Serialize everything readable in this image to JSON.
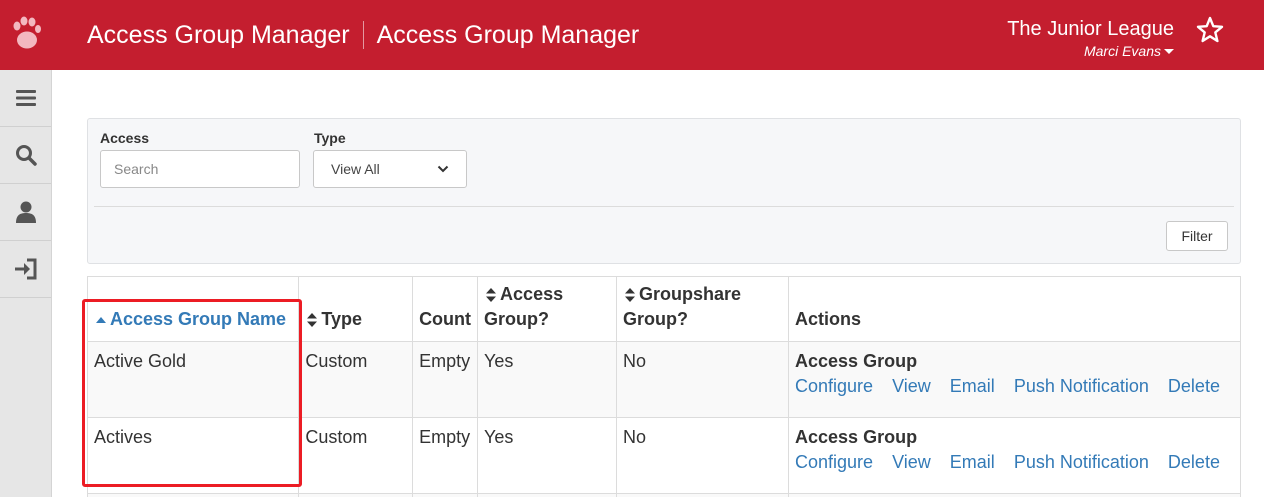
{
  "header": {
    "title_primary": "Access Group Manager",
    "title_secondary": "Access Group Manager",
    "organization": "The Junior League",
    "user_name": "Marci Evans",
    "logo_icon": "paw-icon",
    "favorite_icon": "star-outline-icon"
  },
  "sidebar": {
    "items": [
      {
        "icon": "menu-icon"
      },
      {
        "icon": "search-icon"
      },
      {
        "icon": "user-icon"
      },
      {
        "icon": "sign-in-icon"
      }
    ]
  },
  "filters": {
    "access_label": "Access",
    "access_placeholder": "Search",
    "type_label": "Type",
    "type_value": "View All",
    "filter_button": "Filter"
  },
  "table": {
    "columns": {
      "name": "Access Group Name",
      "type": "Type",
      "count": "Count",
      "access_group_1": "Access",
      "access_group_2": "Group?",
      "groupshare_1": "Groupshare",
      "groupshare_2": "Group?",
      "actions": "Actions"
    },
    "rows": [
      {
        "name": "Active Gold",
        "type": "Custom",
        "count": "Empty",
        "access_group": "Yes",
        "groupshare": "No",
        "action_title": "Access Group",
        "actions": [
          "Configure",
          "View",
          "Email",
          "Push Notification",
          "Delete"
        ]
      },
      {
        "name": "Actives",
        "type": "Custom",
        "count": "Empty",
        "access_group": "Yes",
        "groupshare": "No",
        "action_title": "Access Group",
        "actions": [
          "Configure",
          "View",
          "Email",
          "Push Notification",
          "Delete"
        ]
      }
    ]
  },
  "colors": {
    "brand": "#c41e2f",
    "link": "#337ab7",
    "highlight": "#ec1c24"
  }
}
